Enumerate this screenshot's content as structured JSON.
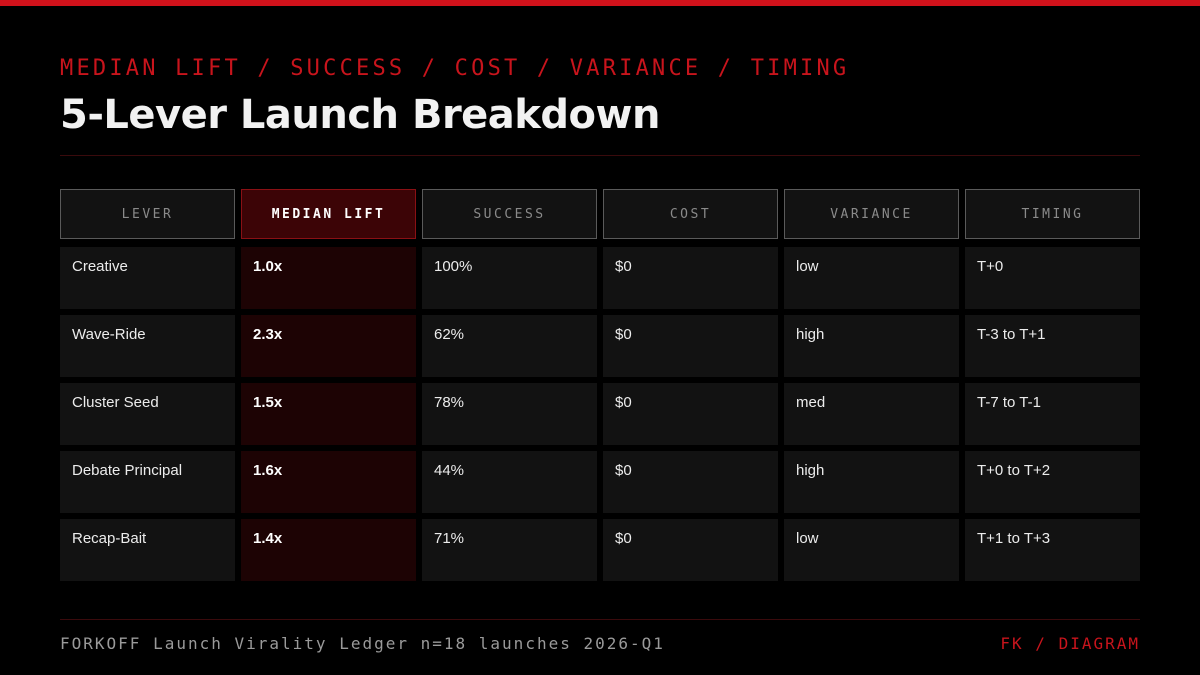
{
  "header": {
    "eyebrow": "MEDIAN LIFT / SUCCESS / COST / VARIANCE / TIMING",
    "title": "5-Lever Launch Breakdown"
  },
  "table": {
    "columns": [
      "LEVER",
      "MEDIAN LIFT",
      "SUCCESS",
      "COST",
      "VARIANCE",
      "TIMING"
    ],
    "highlight_column": "MEDIAN LIFT",
    "rows": [
      [
        "Creative",
        "1.0x",
        "100%",
        "$0",
        "low",
        "T+0"
      ],
      [
        "Wave-Ride",
        "2.3x",
        "62%",
        "$0",
        "high",
        "T-3 to T+1"
      ],
      [
        "Cluster Seed",
        "1.5x",
        "78%",
        "$0",
        "med",
        "T-7 to T-1"
      ],
      [
        "Debate Principal",
        "1.6x",
        "44%",
        "$0",
        "high",
        "T+0 to T+2"
      ],
      [
        "Recap-Bait",
        "1.4x",
        "71%",
        "$0",
        "low",
        "T+1 to T+3"
      ]
    ]
  },
  "footer": {
    "source": "FORKOFF Launch Virality Ledger n=18 launches 2026-Q1",
    "tag": "FK / DIAGRAM"
  },
  "colors": {
    "accent": "#d0121b",
    "background": "#000000",
    "cell": "#121212",
    "highlight_cell": "#1d0304"
  }
}
